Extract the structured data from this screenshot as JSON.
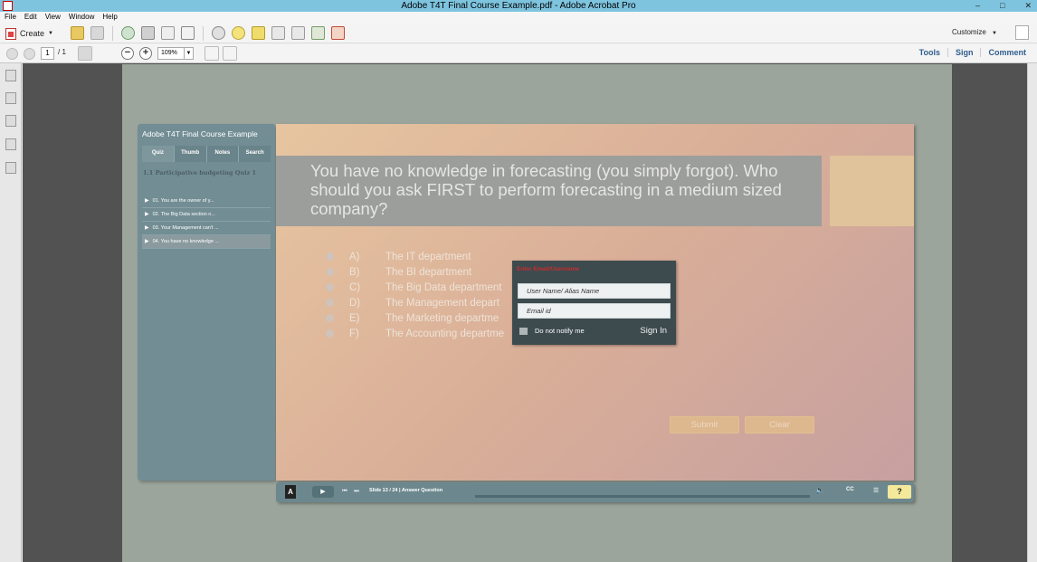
{
  "window": {
    "title": "Adobe T4T Final Course Example.pdf - Adobe Acrobat Pro",
    "controls": [
      "–",
      "□",
      "✕"
    ]
  },
  "menu": [
    "File",
    "Edit",
    "View",
    "Window",
    "Help"
  ],
  "toolbar": {
    "create_label": "Create",
    "customize_label": "Customize"
  },
  "nav": {
    "page_current": "1",
    "page_total": "/ 1",
    "zoom": "109%"
  },
  "right_links": [
    "Tools",
    "Sign",
    "Comment"
  ],
  "course": {
    "title": "Adobe T4T Final Course Example",
    "tabs": [
      "Quiz",
      "Thumb",
      "Notes",
      "Search"
    ],
    "section": "1.1 Participative budgeting Quiz 1",
    "items": [
      "01. You are the owner of y...",
      "02. The Big Data section o...",
      "03. Your Management can't ...",
      "04. You have no knowledge ..."
    ]
  },
  "question": {
    "text": "You have no knowledge in forecasting (you simply forgot). Who should you ask FIRST to perform forecasting in a medium sized company?",
    "answers": [
      {
        "letter": "A)",
        "text": "The IT department"
      },
      {
        "letter": "B)",
        "text": "The BI department"
      },
      {
        "letter": "C)",
        "text": "The Big Data department"
      },
      {
        "letter": "D)",
        "text": "The Management depart"
      },
      {
        "letter": "E)",
        "text": "The Marketing departme"
      },
      {
        "letter": "F)",
        "text": "The Accounting departme"
      }
    ],
    "submit_label": "Submit",
    "clear_label": "Clear"
  },
  "player": {
    "slide_info": "Slide 13 / 24 | Answer Question",
    "cc_label": "CC",
    "help_label": "?"
  },
  "login": {
    "title": "Enter Email/Username",
    "username_placeholder": "User Name/ Alias Name",
    "email_placeholder": "Email id",
    "notify_label": "Do not notify me",
    "signin_label": "Sign In"
  }
}
